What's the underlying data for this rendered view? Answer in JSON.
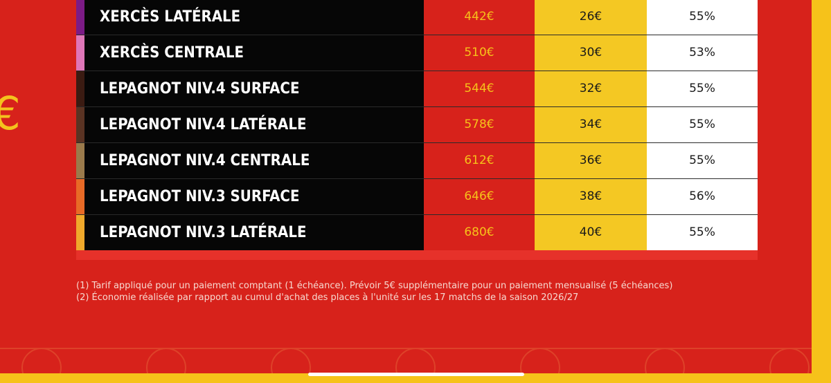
{
  "side_glyph": "€",
  "rows": [
    {
      "name": "XERCÈS LATÉRALE",
      "price": "442€",
      "monthly": "26€",
      "saving": "55%",
      "accent": "#7c1b86"
    },
    {
      "name": "XERCÈS CENTRALE",
      "price": "510€",
      "monthly": "30€",
      "saving": "53%",
      "accent": "#df76b8"
    },
    {
      "name": "LEPAGNOT NIV.4 SURFACE",
      "price": "544€",
      "monthly": "32€",
      "saving": "55%",
      "accent": "#3b1b12"
    },
    {
      "name": "LEPAGNOT NIV.4 LATÉRALE",
      "price": "578€",
      "monthly": "34€",
      "saving": "55%",
      "accent": "#5a3323"
    },
    {
      "name": "LEPAGNOT NIV.4 CENTRALE",
      "price": "612€",
      "monthly": "36€",
      "saving": "55%",
      "accent": "#9a7a4b"
    },
    {
      "name": "LEPAGNOT NIV.3 SURFACE",
      "price": "646€",
      "monthly": "38€",
      "saving": "56%",
      "accent": "#e86a26"
    },
    {
      "name": "LEPAGNOT NIV.3 LATÉRALE",
      "price": "680€",
      "monthly": "40€",
      "saving": "55%",
      "accent": "#f0a92b"
    }
  ],
  "footnotes": [
    "(1) Tarif appliqué pour un paiement comptant (1 échéance). Prévoir 5€ supplémentaire pour un paiement mensualisé (5 échéances)",
    "(2) Économie réalisée par rapport au cumul d'achat des places à l'unité sur les 17 matchs de la saison 2026/27"
  ],
  "colors": {
    "background_red": "#d7221b",
    "frame_yellow": "#f6c21a",
    "name_cell_black": "#060606",
    "monthly_yellow": "#f4c823"
  }
}
